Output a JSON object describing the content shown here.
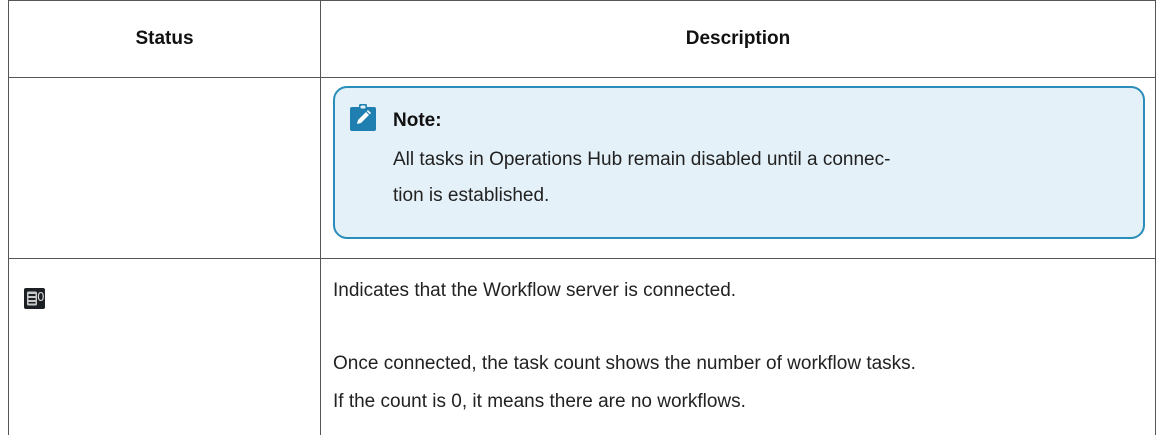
{
  "table": {
    "headers": {
      "status": "Status",
      "description": "Description"
    },
    "rows": [
      {
        "status_icon": "info-note-icon",
        "note": {
          "icon": "pencil-clipboard-icon",
          "title": "Note:",
          "body_line1": "All tasks in Operations Hub remain disabled until a connec-",
          "body_line2": "tion is established."
        }
      },
      {
        "status_icon": "workflow-server-icon",
        "status_count": "0",
        "description_line1": "Indicates that the Workflow server is connected.",
        "description_line2": "Once connected, the task count shows the number of workflow tasks.",
        "description_line3": "If the count is 0, it means there are no workflows."
      }
    ]
  },
  "colors": {
    "note_background": "#e4f1f8",
    "note_border": "#2b8db9",
    "icon_background": "#1c1f24"
  }
}
